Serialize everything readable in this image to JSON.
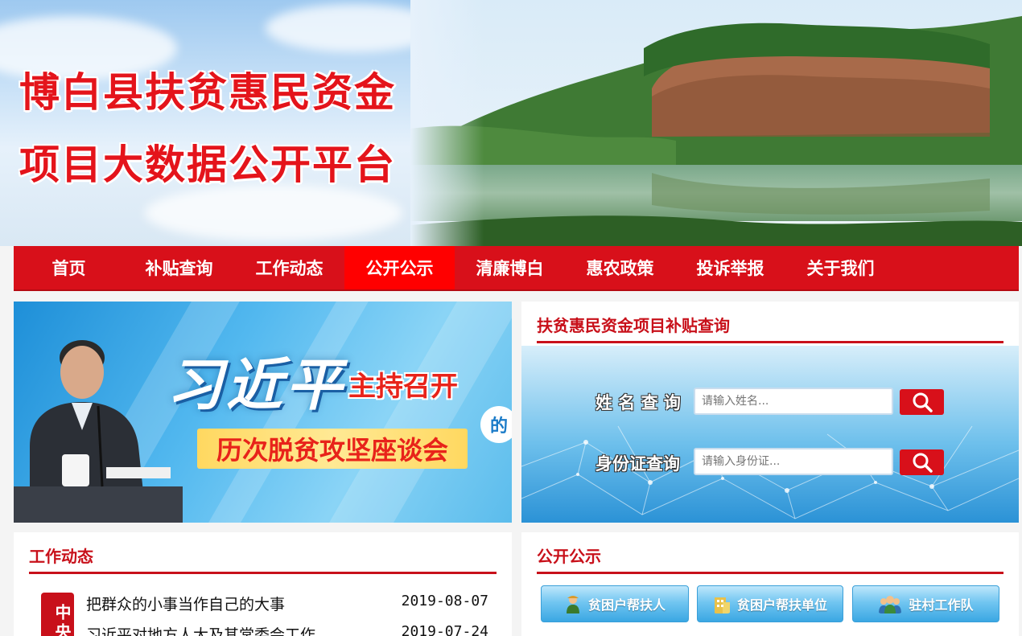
{
  "site": {
    "title_line1": "博白县扶贫惠民资金",
    "title_line2": "项目大数据公开平台"
  },
  "nav": {
    "items": [
      "首页",
      "补贴查询",
      "工作动态",
      "公开公示",
      "清廉博白",
      "惠农政策",
      "投诉举报",
      "关于我们"
    ],
    "active_index": 3
  },
  "promo": {
    "name": "习近平",
    "sub1": "主持召开",
    "de": "的",
    "sub2": "历次脱贫攻坚座谈会"
  },
  "query": {
    "title": "扶贫惠民资金项目补贴查询",
    "name_label": "姓 名 查 询",
    "name_placeholder": "请输入姓名...",
    "id_label": "身份证查询",
    "id_placeholder": "请输入身份证...",
    "search_icon": "search-icon"
  },
  "news": {
    "title": "工作动态",
    "tag": "中央",
    "items": [
      {
        "title": "把群众的小事当作自己的大事",
        "date": "2019-08-07"
      },
      {
        "title": "习近平对地方人大及其常委会工作",
        "date": "2019-07-24"
      }
    ]
  },
  "notice": {
    "title": "公开公示",
    "buttons": [
      {
        "label": "贫困户帮扶人",
        "icon": "farmer-icon"
      },
      {
        "label": "贫困户帮扶单位",
        "icon": "building-icon"
      },
      {
        "label": "驻村工作队",
        "icon": "team-icon"
      }
    ]
  },
  "colors": {
    "primary_red": "#d8101a",
    "active_red": "#ff0000",
    "panel_title": "#c8101a",
    "button_blue": "#3aa7e3"
  }
}
